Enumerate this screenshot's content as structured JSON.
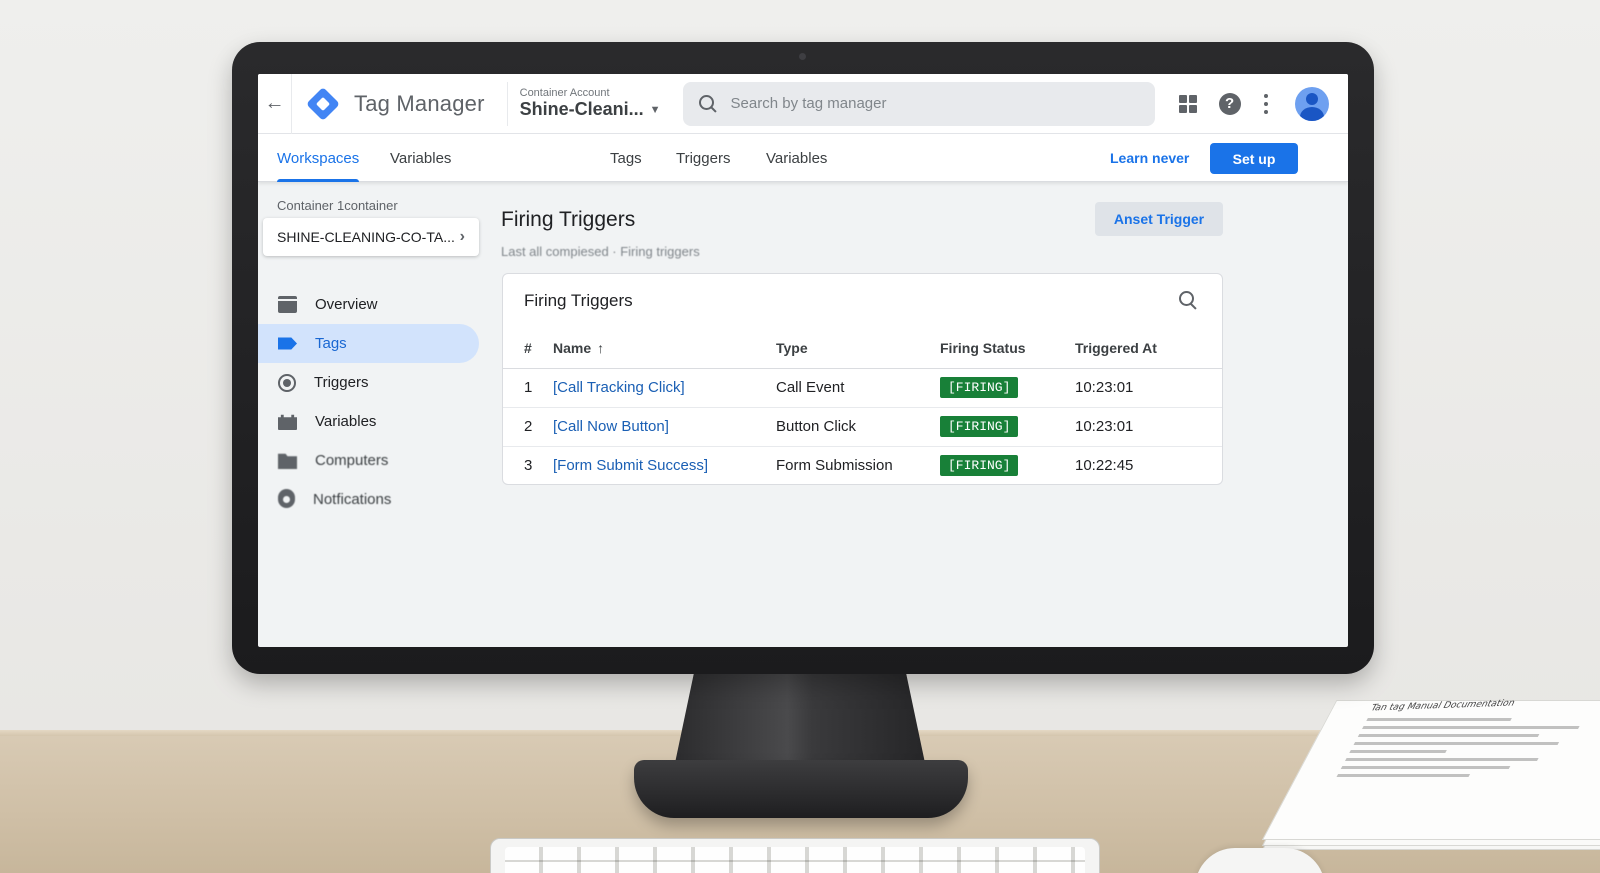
{
  "app": {
    "name": "Tag Manager",
    "account_label": "Container Account",
    "account_value": "Shine-Cleani...",
    "search_placeholder": "Search by tag manager"
  },
  "nav": {
    "tabs": [
      {
        "label": "Workspaces",
        "active": true
      },
      {
        "label": "Variables"
      },
      {
        "label": "Tags"
      },
      {
        "label": "Triggers"
      },
      {
        "label": "Variables"
      }
    ],
    "learn_link": "Learn never",
    "setup_button": "Set up"
  },
  "sidebar": {
    "container_label": "Container 1container",
    "container_name": "SHINE-CLEANING-CO-TA...",
    "items": [
      {
        "label": "Overview",
        "icon": "overview-icon"
      },
      {
        "label": "Tags",
        "icon": "tag-icon",
        "active": true
      },
      {
        "label": "Triggers",
        "icon": "trigger-icon"
      },
      {
        "label": "Variables",
        "icon": "variable-icon"
      },
      {
        "label": "Computers",
        "icon": "folder-icon"
      },
      {
        "label": "Notfications",
        "icon": "gear-icon"
      }
    ]
  },
  "main": {
    "title": "Firing Triggers",
    "subtitle": "Last all compiesed · Firing triggers",
    "add_button": "Anset Trigger",
    "card": {
      "title": "Firing Triggers",
      "columns": [
        "#",
        "Name",
        "Type",
        "Firing Status",
        "Triggered At"
      ],
      "sort_indicator": "↑",
      "rows": [
        {
          "num": "1",
          "name": "[Call Tracking Click]",
          "type": "Call Event",
          "status": "[FIRING]",
          "time": "10:23:01"
        },
        {
          "num": "2",
          "name": "[Call Now Button]",
          "type": "Button Click",
          "status": "[FIRING]",
          "time": "10:23:01"
        },
        {
          "num": "3",
          "name": "[Form Submit Success]",
          "type": "Form Submission",
          "status": "[FIRING]",
          "time": "10:22:45"
        }
      ]
    }
  },
  "desk_document": {
    "title": "Tan tag Manual Documentation"
  },
  "colors": {
    "accent": "#1a73e8",
    "firing_badge": "#188038",
    "active_nav_bg": "#d2e3fc"
  }
}
